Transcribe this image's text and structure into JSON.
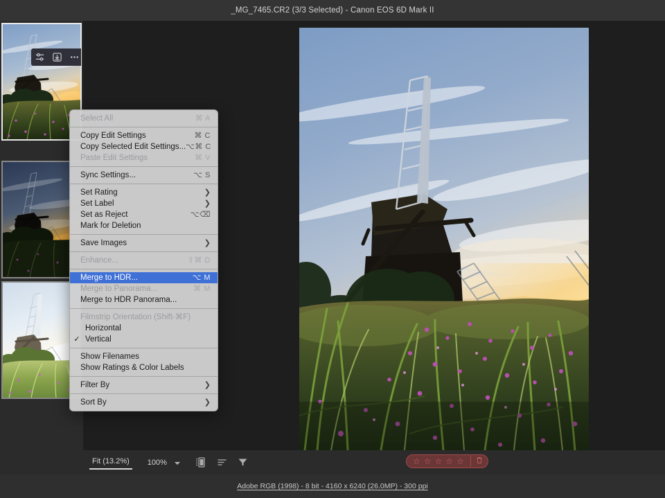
{
  "titlebar": {
    "filename": "_MG_7465.CR2",
    "selection": "(3/3 Selected)",
    "separator": "-",
    "camera": "Canon EOS 6D Mark II",
    "full": "_MG_7465.CR2 (3/3 Selected)  -  Canon EOS 6D Mark II"
  },
  "filmstrip": {
    "orientation": "Vertical",
    "thumbnails": [
      {
        "name": "thumbnail-1",
        "selected": true,
        "exposure": "normal"
      },
      {
        "name": "thumbnail-2",
        "selected": false,
        "exposure": "under"
      },
      {
        "name": "thumbnail-3",
        "selected": false,
        "exposure": "over"
      }
    ],
    "hover_toolbar": {
      "adjust_icon": "sliders-icon",
      "export_icon": "download-icon",
      "more_icon": "ellipsis-icon"
    }
  },
  "toolbar": {
    "zoom_fit_label": "Fit (13.2%)",
    "zoom_100_label": "100%",
    "dropdown_icon": "chevron-down-icon",
    "filmstrip_toggle_icon": "filmstrip-icon",
    "sort_icon": "sort-icon",
    "filter_icon": "filter-funnel-icon"
  },
  "rating": {
    "stars": [
      "☆",
      "☆",
      "☆",
      "☆",
      "☆"
    ],
    "rating_value": 0,
    "reject_icon": "trash-icon",
    "pill_color": "#6b3636",
    "pill_border": "#9c4a46",
    "glyph_color": "#c76a63"
  },
  "statusbar": {
    "text": "Adobe RGB (1998) - 8 bit - 4160 x 6240 (26.0MP) - 300 ppi",
    "color_space": "Adobe RGB (1998)",
    "bit_depth": "8 bit",
    "dimensions": "4160 x 6240",
    "megapixels": "(26.0MP)",
    "resolution": "300 ppi"
  },
  "context_menu": {
    "highlight_color": "#3f70d6",
    "background_color": "#cecece",
    "groups": [
      {
        "items": [
          {
            "label": "Select All",
            "shortcut": "⌘ A",
            "disabled": true,
            "submenu": false,
            "checked": false,
            "selected": false,
            "indent": false
          }
        ]
      },
      {
        "items": [
          {
            "label": "Copy Edit Settings",
            "shortcut": "⌘ C",
            "disabled": false,
            "submenu": false,
            "checked": false,
            "selected": false,
            "indent": false
          },
          {
            "label": "Copy Selected Edit Settings...",
            "shortcut": "⌥⌘ C",
            "disabled": false,
            "submenu": false,
            "checked": false,
            "selected": false,
            "indent": false
          },
          {
            "label": "Paste Edit Settings",
            "shortcut": "⌘ V",
            "disabled": true,
            "submenu": false,
            "checked": false,
            "selected": false,
            "indent": false
          }
        ]
      },
      {
        "items": [
          {
            "label": "Sync Settings...",
            "shortcut": "⌥ S",
            "disabled": false,
            "submenu": false,
            "checked": false,
            "selected": false,
            "indent": false
          }
        ]
      },
      {
        "items": [
          {
            "label": "Set Rating",
            "shortcut": "",
            "disabled": false,
            "submenu": true,
            "checked": false,
            "selected": false,
            "indent": false
          },
          {
            "label": "Set Label",
            "shortcut": "",
            "disabled": false,
            "submenu": true,
            "checked": false,
            "selected": false,
            "indent": false
          },
          {
            "label": "Set as Reject",
            "shortcut": "⌥⌫",
            "disabled": false,
            "submenu": false,
            "checked": false,
            "selected": false,
            "indent": false
          },
          {
            "label": "Mark for Deletion",
            "shortcut": "",
            "disabled": false,
            "submenu": false,
            "checked": false,
            "selected": false,
            "indent": false
          }
        ]
      },
      {
        "items": [
          {
            "label": "Save Images",
            "shortcut": "",
            "disabled": false,
            "submenu": true,
            "checked": false,
            "selected": false,
            "indent": false
          }
        ]
      },
      {
        "items": [
          {
            "label": "Enhance...",
            "shortcut": "⇧⌘ D",
            "disabled": true,
            "submenu": false,
            "checked": false,
            "selected": false,
            "indent": false
          }
        ]
      },
      {
        "items": [
          {
            "label": "Merge to HDR...",
            "shortcut": "⌥ M",
            "disabled": false,
            "submenu": false,
            "checked": false,
            "selected": true,
            "indent": false
          },
          {
            "label": "Merge to Panorama...",
            "shortcut": "⌘ M",
            "disabled": true,
            "submenu": false,
            "checked": false,
            "selected": false,
            "indent": false
          },
          {
            "label": "Merge to HDR Panorama...",
            "shortcut": "",
            "disabled": false,
            "submenu": false,
            "checked": false,
            "selected": false,
            "indent": false
          }
        ]
      },
      {
        "items": [
          {
            "label": "Filmstrip Orientation (Shift-⌘F)",
            "shortcut": "",
            "disabled": true,
            "submenu": false,
            "checked": false,
            "selected": false,
            "indent": false
          },
          {
            "label": "Horizontal",
            "shortcut": "",
            "disabled": false,
            "submenu": false,
            "checked": false,
            "selected": false,
            "indent": true
          },
          {
            "label": "Vertical",
            "shortcut": "",
            "disabled": false,
            "submenu": false,
            "checked": true,
            "selected": false,
            "indent": true
          }
        ]
      },
      {
        "items": [
          {
            "label": "Show Filenames",
            "shortcut": "",
            "disabled": false,
            "submenu": false,
            "checked": false,
            "selected": false,
            "indent": false
          },
          {
            "label": "Show Ratings & Color Labels",
            "shortcut": "",
            "disabled": false,
            "submenu": false,
            "checked": false,
            "selected": false,
            "indent": false
          }
        ]
      },
      {
        "items": [
          {
            "label": "Filter By",
            "shortcut": "",
            "disabled": false,
            "submenu": true,
            "checked": false,
            "selected": false,
            "indent": false
          }
        ]
      },
      {
        "items": [
          {
            "label": "Sort By",
            "shortcut": "",
            "disabled": false,
            "submenu": true,
            "checked": false,
            "selected": false,
            "indent": false
          }
        ]
      }
    ]
  }
}
